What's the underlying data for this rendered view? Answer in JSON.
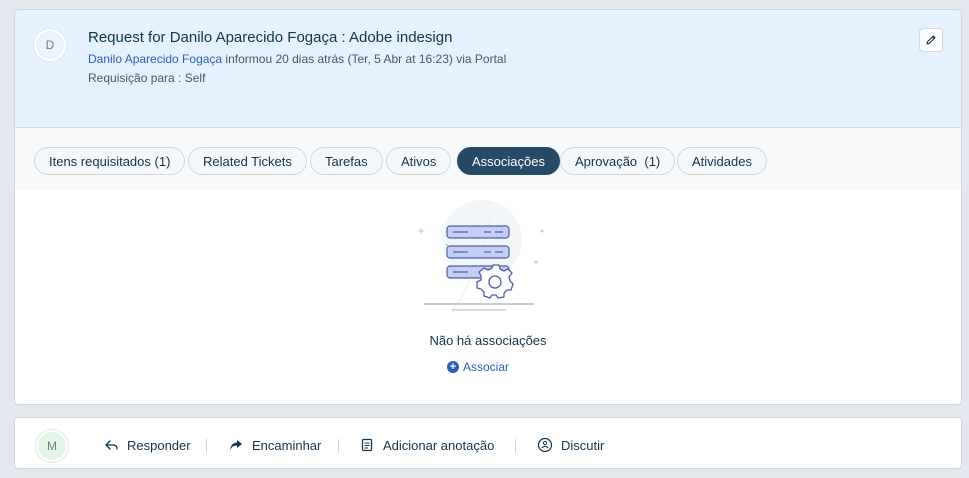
{
  "header": {
    "avatar_initial": "D",
    "title": "Request for Danilo Aparecido Fogaça : Adobe indesign",
    "requester": "Danilo Aparecido Fogaça",
    "info": " informou 20 dias atrás (Ter, 5 Abr at 16:23) via Portal",
    "requisition": "Requisição para : Self"
  },
  "tabs": [
    {
      "label": "Itens requisitados (1)"
    },
    {
      "label": "Related Tickets"
    },
    {
      "label": "Tarefas"
    },
    {
      "label": "Ativos"
    },
    {
      "label": "Associações",
      "active": true
    },
    {
      "label": "Aprovação  (1)"
    },
    {
      "label": "Atividades"
    }
  ],
  "empty_state": {
    "message": "Não há associações",
    "associate_label": "Associar"
  },
  "footer": {
    "avatar_initial": "M",
    "actions": [
      {
        "label": "Responder",
        "icon": "reply-icon"
      },
      {
        "label": "Encaminhar",
        "icon": "forward-icon"
      },
      {
        "label": "Adicionar anotação",
        "icon": "note-icon"
      },
      {
        "label": "Discutir",
        "icon": "discuss-icon"
      }
    ]
  },
  "colors": {
    "header_bg": "#e5f2fd",
    "active_tab": "#264966",
    "link": "#2c5cc5"
  }
}
